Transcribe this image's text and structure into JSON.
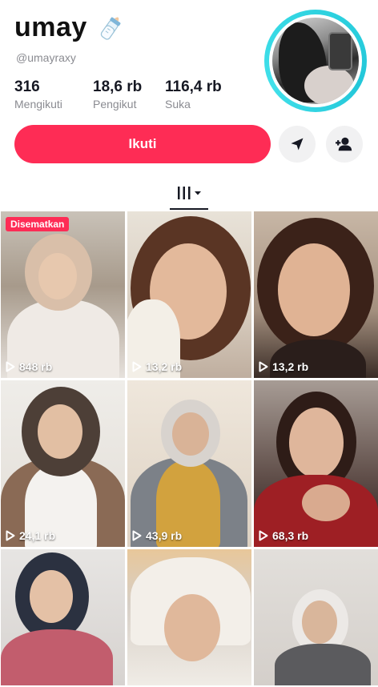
{
  "profile": {
    "name": "umay",
    "handle": "@umayraxy",
    "stats": [
      {
        "value": "316",
        "label": "Mengikuti"
      },
      {
        "value": "18,6 rb",
        "label": "Pengikut"
      },
      {
        "value": "116,4 rb",
        "label": "Suka"
      }
    ],
    "follow_label": "Ikuti",
    "icons": [
      "baby-bottle-icon",
      "send-icon",
      "add-user-icon",
      "grid-icon",
      "chevron-down-icon"
    ]
  },
  "accent": "#fe2c55",
  "story_ring": "#2fd3e0",
  "grid": {
    "pinned_label": "Disematkan",
    "videos": [
      {
        "views": "848 rb"
      },
      {
        "views": "13,2 rb"
      },
      {
        "views": "13,2 rb"
      },
      {
        "views": "24,1 rb"
      },
      {
        "views": "43,9 rb"
      },
      {
        "views": "68,3 rb"
      },
      {
        "views": ""
      },
      {
        "views": ""
      },
      {
        "views": ""
      }
    ]
  }
}
